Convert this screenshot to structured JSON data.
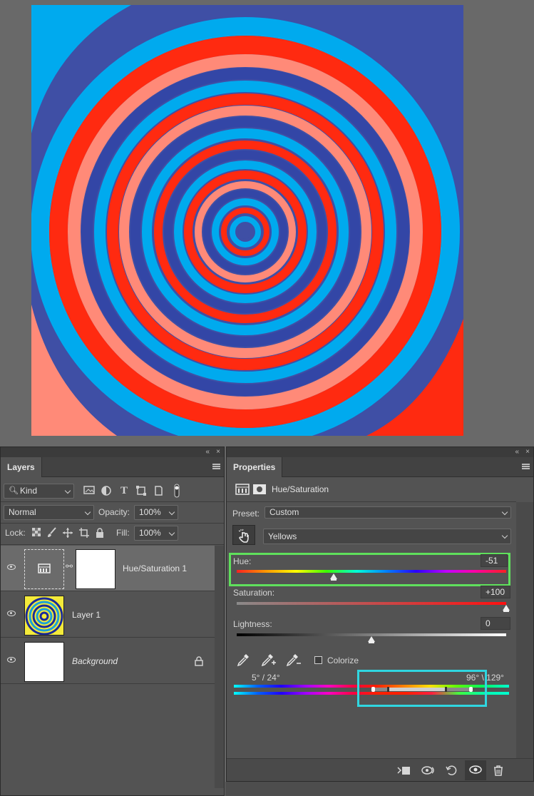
{
  "layers_panel": {
    "tab_label": "Layers",
    "collapse_glyph": "«",
    "close_glyph": "×",
    "filter_label": "Kind",
    "blend_mode": "Normal",
    "opacity_label": "Opacity:",
    "opacity_value": "100%",
    "lock_label": "Lock:",
    "fill_label": "Fill:",
    "fill_value": "100%",
    "layers": [
      {
        "name": "Hue/Saturation 1",
        "type": "adjustment",
        "selected": true
      },
      {
        "name": "Layer 1",
        "type": "image",
        "selected": false
      },
      {
        "name": "Background",
        "type": "background",
        "selected": false,
        "locked": true
      }
    ]
  },
  "properties_panel": {
    "tab_label": "Properties",
    "collapse_glyph": "«",
    "close_glyph": "×",
    "title": "Hue/Saturation",
    "preset_label": "Preset:",
    "preset_value": "Custom",
    "channel_value": "Yellows",
    "hue": {
      "label": "Hue:",
      "value": "-51",
      "level": 0.36
    },
    "saturation": {
      "label": "Saturation:",
      "value": "+100",
      "level": 1.0
    },
    "lightness": {
      "label": "Lightness:",
      "value": "0",
      "level": 0.5
    },
    "colorize_label": "Colorize",
    "colorize_checked": false,
    "range_left": "5° / 24°",
    "range_right": "96° \\ 129°"
  },
  "colors": {
    "hue_highlight": "#5fe05c",
    "range_highlight": "#2fd6e0",
    "panel_bg": "#535353",
    "canvas_bg": "#696969"
  },
  "icons": {
    "filter": "search-icon",
    "lock": "lock-icon",
    "visibility": "eye-icon",
    "link": "chain-link-icon"
  }
}
